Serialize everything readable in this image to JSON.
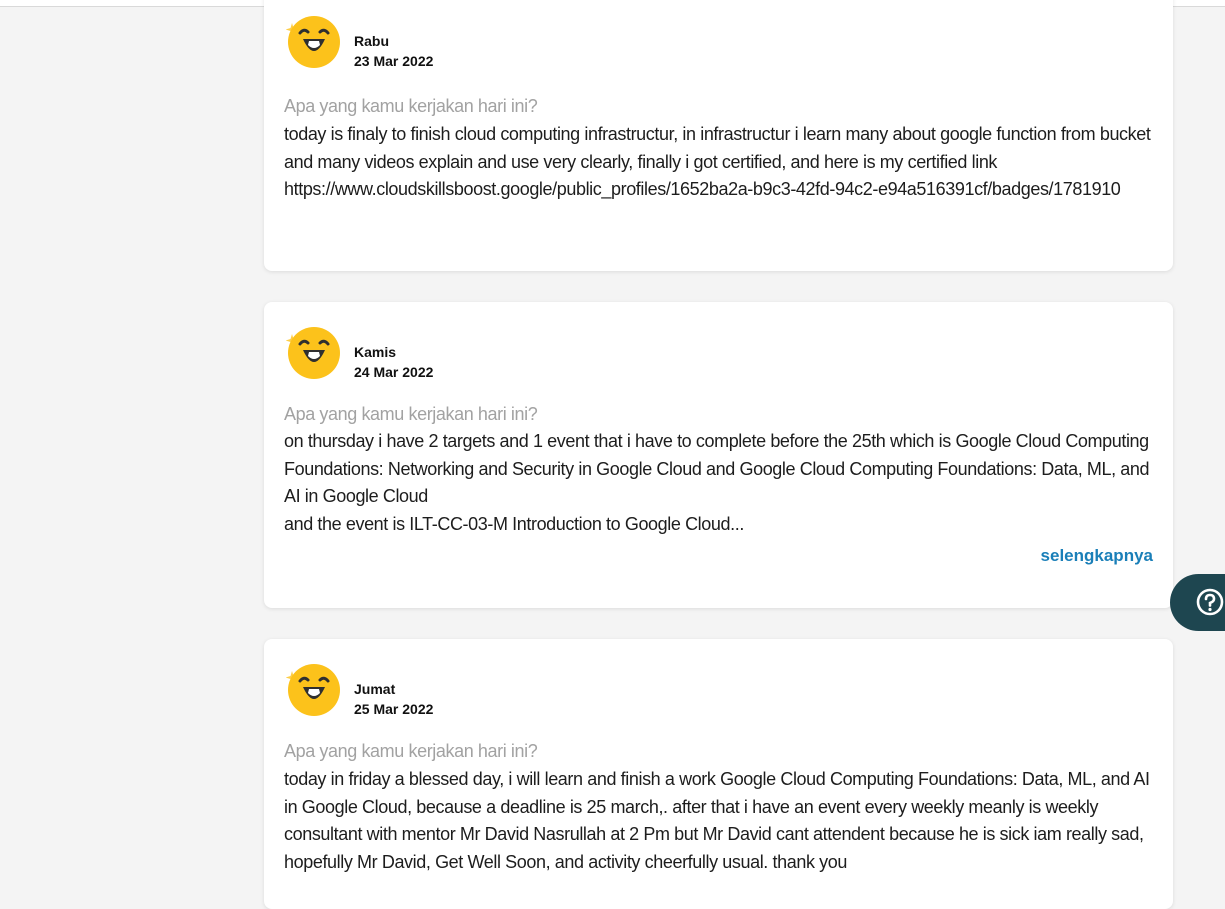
{
  "entries": [
    {
      "day": "Rabu",
      "date": "23 Mar 2022",
      "question": "Apa yang kamu kerjakan hari ini?",
      "lines": [
        "today is finaly to finish cloud computing infrastructur, in infrastructur i learn many about google function from bucket and  many videos explain and use very clearly, finally i got certified, and here is my certified link https://www.cloudskillsboost.google/public_profiles/1652ba2a-b9c3-42fd-94c2-e94a516391cf/badges/1781910"
      ]
    },
    {
      "day": "Kamis",
      "date": "24 Mar 2022",
      "question": "Apa yang kamu kerjakan hari ini?",
      "lines": [
        "on thursday i have 2 targets and 1 event that i have to complete before the 25th which is Google Cloud Computing Foundations: Networking and Security in Google Cloud and Google Cloud Computing Foundations: Data, ML, and AI in Google Cloud",
        "and the event is ILT-CC-03-M Introduction to Google Cloud..."
      ],
      "more_label": "selengkapnya"
    },
    {
      "day": "Jumat",
      "date": "25 Mar 2022",
      "question": "Apa yang kamu kerjakan hari ini?",
      "lines": [
        "today in friday a blessed day, i will learn and finish a work Google Cloud Computing Foundations: Data, ML, and AI in Google Cloud, because a deadline is 25 march,. after that i have an event every weekly meanly is weekly consultant with mentor Mr David Nasrullah at 2 Pm but Mr David cant attendent because he is sick iam really sad, hopefully Mr David, Get Well Soon, and activity cheerfully usual. thank you"
      ]
    }
  ],
  "icons": {
    "mood": "laughing-face-icon",
    "help": "question-icon"
  },
  "colors": {
    "accent_link": "#1a7fb8",
    "help_button": "#1e4650",
    "question_text": "#a2a2a2",
    "emoji_face": "#fcc21b"
  }
}
